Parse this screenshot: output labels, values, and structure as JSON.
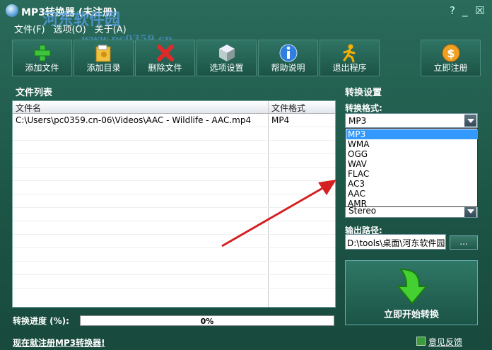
{
  "window": {
    "title": "MP3转换器 (未注册)",
    "watermark": "河东软件园",
    "watermark_url": "www.pc0359.cn",
    "controls": [
      "?",
      "_",
      "☒"
    ]
  },
  "menu": [
    "文件(F)",
    "选项(O)",
    "关于(A)"
  ],
  "toolbar": [
    {
      "label": "添加文件",
      "icon": "add-icon"
    },
    {
      "label": "添加目录",
      "icon": "folder-icon"
    },
    {
      "label": "删除文件",
      "icon": "delete-icon"
    },
    {
      "label": "选项设置",
      "icon": "settings-cube-icon"
    },
    {
      "label": "帮助说明",
      "icon": "info-icon"
    },
    {
      "label": "退出程序",
      "icon": "exit-runner-icon"
    },
    {
      "label": "立即注册",
      "icon": "register-coin-icon"
    }
  ],
  "file_list": {
    "title": "文件列表",
    "columns": [
      "文件名",
      "文件格式"
    ],
    "rows": [
      {
        "name": "C:\\Users\\pc0359.cn-06\\Videos\\AAC - Wildlife - AAC.mp4",
        "format": "MP4"
      }
    ]
  },
  "settings": {
    "title": "转换设置",
    "format_label": "转换格式:",
    "format_value": "MP3",
    "format_options": [
      "MP3",
      "WMA",
      "OGG",
      "WAV",
      "FLAC",
      "AC3",
      "AAC",
      "AMR"
    ],
    "channel_value": "Stereo",
    "output_label": "输出路径:",
    "output_path": "D:\\tools\\桌面\\河东软件园",
    "browse_label": "...",
    "start_label": "立即开始转换"
  },
  "progress": {
    "label": "转换进度 (%):",
    "value": 0,
    "text": "0%"
  },
  "footer": {
    "register_link": "现在就注册MP3转换器!",
    "feedback": "意见反馈"
  },
  "colors": {
    "background": "#1f5a4c",
    "selection": "#3399ff",
    "annotation_arrow": "#d42020"
  }
}
